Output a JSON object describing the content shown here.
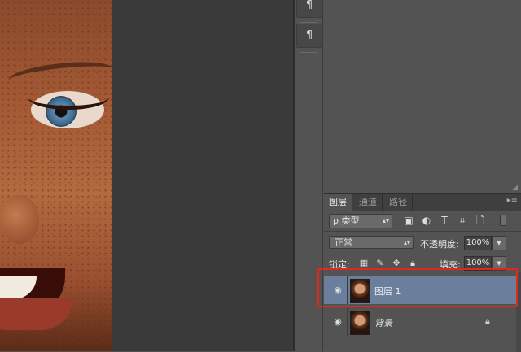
{
  "tools": [
    {
      "icon": "paragraph-icon",
      "glyph": "¶"
    },
    {
      "icon": "paragraph-style-icon",
      "glyph": "¶"
    }
  ],
  "layers_panel": {
    "tabs": [
      "图层",
      "通道",
      "路径"
    ],
    "active_tab": "图层",
    "filter": {
      "icon": "search-icon",
      "glyph": "ρ",
      "label": "类型"
    },
    "filter_icons": [
      {
        "name": "pixel-filter-icon",
        "glyph": "▣"
      },
      {
        "name": "adjustment-filter-icon",
        "glyph": "◐"
      },
      {
        "name": "type-filter-icon",
        "glyph": "T"
      },
      {
        "name": "shape-filter-icon",
        "glyph": "⌗"
      },
      {
        "name": "smart-object-filter-icon",
        "glyph": "🗋"
      }
    ],
    "blend_mode": "正常",
    "opacity_label": "不透明度:",
    "opacity_value": "100%",
    "lock_label": "锁定:",
    "fill_label": "填充:",
    "fill_value": "100%",
    "layers": [
      {
        "name": "图层 1",
        "selected": true,
        "visible": true,
        "locked": false
      },
      {
        "name": "背景",
        "selected": false,
        "visible": true,
        "locked": true
      }
    ]
  },
  "colors": {
    "selection": "#6b7f9c",
    "highlight_box": "#e1281e",
    "panel_bg": "#535353",
    "pasteboard": "#3a3a3a"
  }
}
